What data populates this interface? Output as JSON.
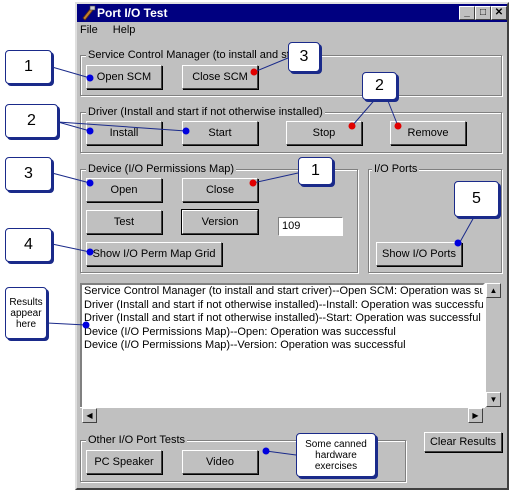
{
  "window": {
    "title": "Port I/O Test"
  },
  "menu": {
    "file": "File",
    "help": "Help"
  },
  "scm_group": {
    "label": "Service Control Manager (to install and st",
    "open": "Open SCM",
    "close": "Close SCM"
  },
  "driver_group": {
    "label": "Driver (Install and start if not otherwise installed)",
    "install": "Install",
    "start": "Start",
    "stop": "Stop",
    "remove": "Remove"
  },
  "device_group": {
    "label": "Device (I/O Permissions Map)",
    "open": "Open",
    "close": "Close",
    "test": "Test",
    "version": "Version",
    "version_value": "109",
    "show_grid": "Show I/O Perm Map Grid"
  },
  "ports_group": {
    "label": "I/O Ports",
    "show_ports": "Show I/O Ports"
  },
  "results": {
    "lines": [
      "Service Control Manager (to install and start criver)--Open SCM: Operation was succe:",
      "Driver (Install and start if not otherwise installed)--Install: Operation was successful",
      "Driver (Install and start if not otherwise installed)--Start: Operation was successful",
      "Device (I/O Permissions Map)--Open: Operation was successful",
      "Device (I/O Permissions Map)--Version: Operation was successful"
    ]
  },
  "other_group": {
    "label": "Other I/O Port Tests",
    "pc_speaker": "PC Speaker",
    "video": "Video"
  },
  "clear_results": "Clear Results",
  "callouts": {
    "c1a": "1",
    "c1b": "1",
    "c2a": "2",
    "c2b": "2",
    "c3a": "3",
    "c3b": "3",
    "c4": "4",
    "c5": "5",
    "results_note": "Results appear here",
    "canned_note": "Some canned hardware exercises"
  },
  "colors": {
    "title_bar": "#000080",
    "face": "#c0c0c0",
    "callout_border": "#1a2a8a",
    "blue_dot": "#0000dd",
    "red_dot": "#e00000"
  }
}
